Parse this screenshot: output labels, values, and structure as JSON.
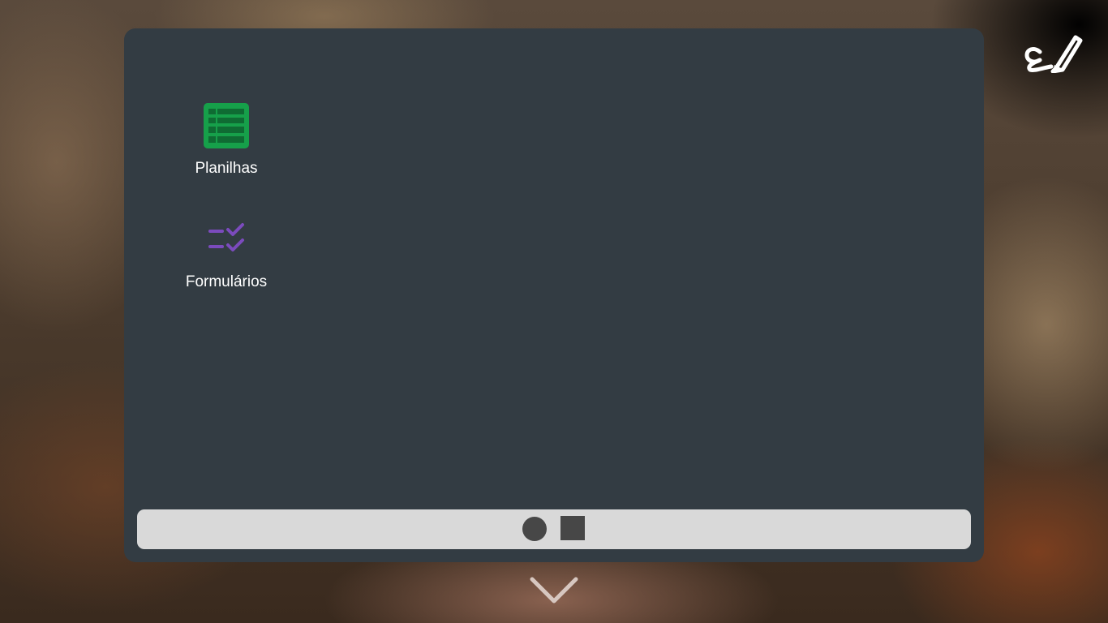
{
  "apps": [
    {
      "label": "Planilhas",
      "icon": "spreadsheet-icon",
      "color": "#16a04a"
    },
    {
      "label": "Formulários",
      "icon": "checklist-icon",
      "color": "#7b4bbd"
    }
  ],
  "toolbar": {
    "edit_icon": "pen-scribble-icon"
  },
  "taskbar": {
    "items": [
      "circle-icon",
      "square-icon"
    ]
  },
  "footer": {
    "collapse_icon": "chevron-down-icon"
  },
  "colors": {
    "panel": "#333c43",
    "taskbar": "#d9d9d9",
    "taskbar_item": "#474747"
  }
}
